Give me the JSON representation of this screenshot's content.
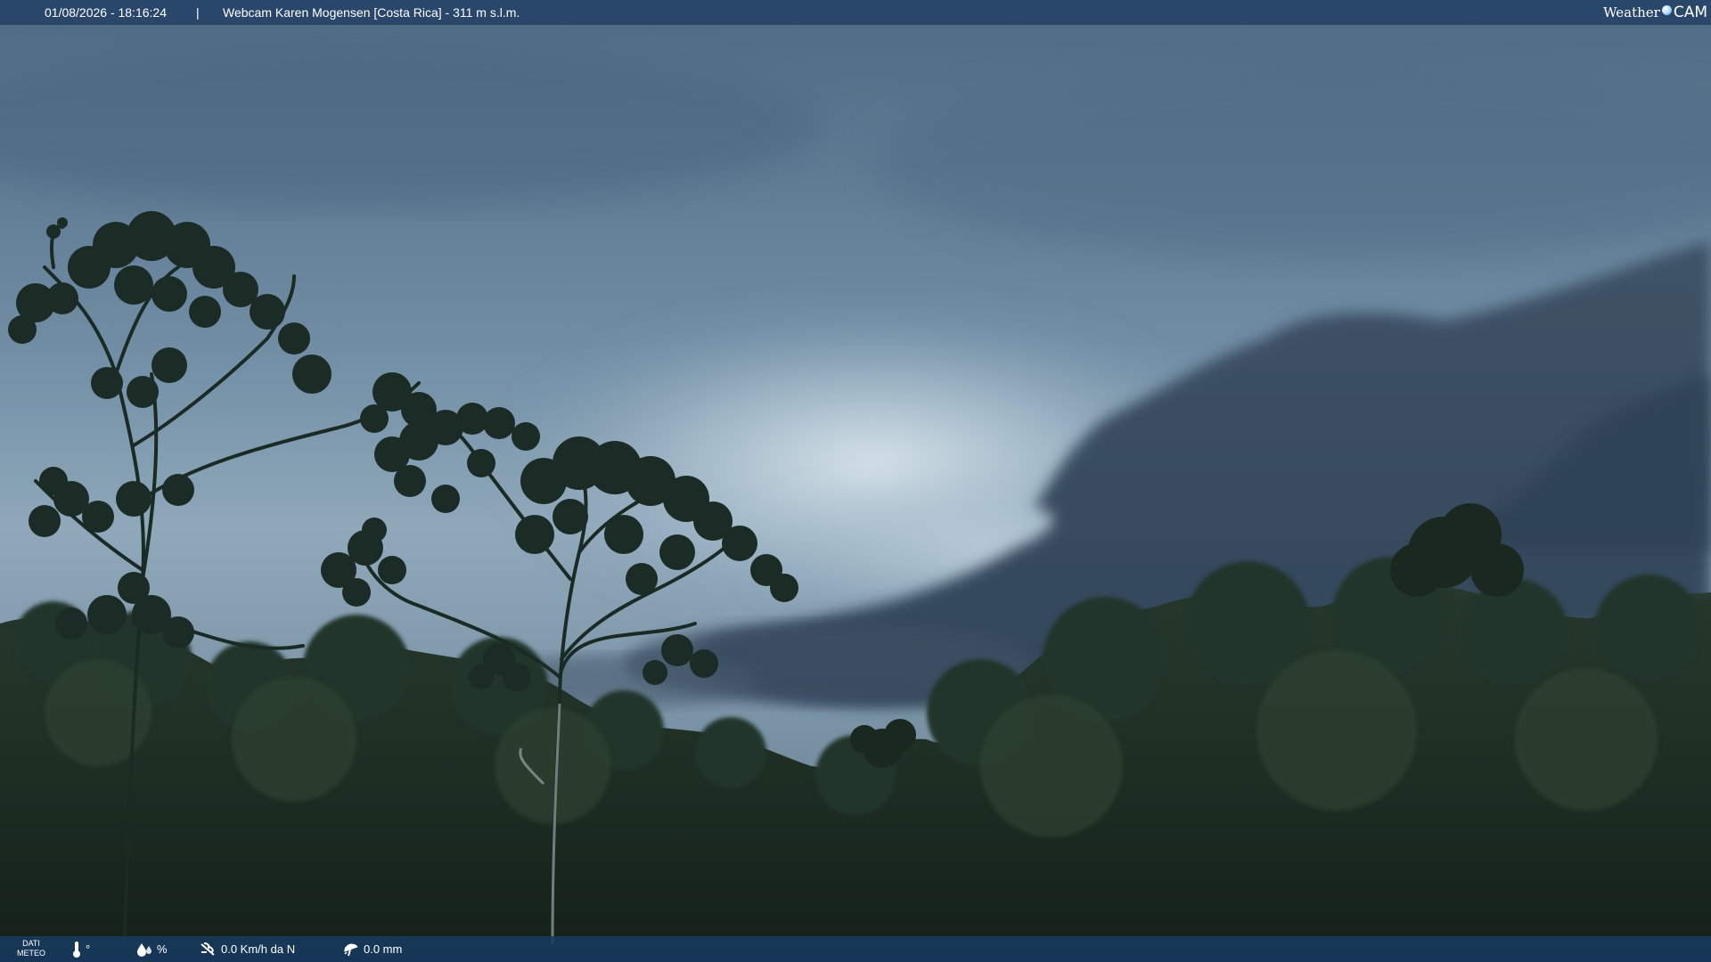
{
  "header": {
    "timestamp": "01/08/2026 - 18:16:24",
    "separator": "|",
    "title": "Webcam Karen Mogensen [Costa Rica]  - 311 m s.l.m."
  },
  "logo": {
    "weather": "Weather",
    "cam": "CAM",
    "icon": "globe-icon"
  },
  "meteo": {
    "label_line1": "DATI",
    "label_line2": "METEO",
    "temperature": "°",
    "temperature_icon": "thermometer-icon",
    "humidity": "%",
    "humidity_icon": "water-drops-icon",
    "wind": "0.0 Km/h da N",
    "wind_icon": "wind-icon",
    "rain": "0.0 mm",
    "rain_icon": "umbrella-icon"
  },
  "colors": {
    "bar_top": "#244268",
    "bar_bottom": "#183a60",
    "sky_top": "#4e6b85",
    "sky_bright": "#c6d8e4",
    "forest": "#1e2d24"
  }
}
